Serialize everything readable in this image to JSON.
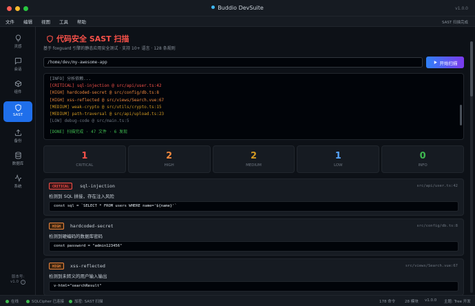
{
  "window": {
    "title": "Buddio DevSuite",
    "version": "v1.0.0",
    "traffic_lights": [
      "#ff5f57",
      "#febc2e",
      "#28c840"
    ]
  },
  "menu": {
    "items": [
      "文件",
      "编辑",
      "视图",
      "工具",
      "帮助"
    ],
    "status": "SAST 扫描完成"
  },
  "sidebar": {
    "items": [
      {
        "label": "灵感",
        "icon": "lightbulb-icon"
      },
      {
        "label": "会话",
        "icon": "chat-icon"
      },
      {
        "label": "组件",
        "icon": "box-icon"
      },
      {
        "label": "SAST",
        "icon": "shield-icon"
      },
      {
        "label": "备份",
        "icon": "upload-icon"
      },
      {
        "label": "数据库",
        "icon": "database-icon"
      },
      {
        "label": "系统",
        "icon": "activity-icon"
      }
    ],
    "active": "SAST",
    "version_label": "版本号",
    "version": "v1.0"
  },
  "page": {
    "title": "代码安全 SAST 扫描",
    "subtitle": "基于 foxguard 引擎的静态应用安全测试 · 支持 10+ 语言 · 128 条规则",
    "path_value": "/home/dev/my-awesome-app",
    "scan_button": "开始扫描"
  },
  "console": {
    "lines": [
      {
        "text": "[INFO] 分析依赖...",
        "level": "info"
      },
      {
        "text": "[CRITICAL] sql-injection @ src/api/user.ts:42",
        "level": "critical"
      },
      {
        "text": "[HIGH] hardcoded-secret @ src/config/db.ts:8",
        "level": "high"
      },
      {
        "text": "[HIGH] xss-reflected @ src/views/Search.vue:67",
        "level": "high"
      },
      {
        "text": "[MEDIUM] weak-crypto @ src/utils/crypto.ts:15",
        "level": "medium"
      },
      {
        "text": "[MEDIUM] path-traversal @ src/api/upload.ts:23",
        "level": "medium"
      },
      {
        "text": "[LOW] debug-code @ src/main.ts:5",
        "level": "low"
      },
      {
        "text": "[DONE] 扫描完成 · 47 文件 · 6 发现",
        "level": "done"
      }
    ]
  },
  "stats": [
    {
      "count": "1",
      "label": "CRITICAL",
      "color": "#f85149"
    },
    {
      "count": "2",
      "label": "HIGH",
      "color": "#f0883e"
    },
    {
      "count": "2",
      "label": "MEDIUM",
      "color": "#d29922"
    },
    {
      "count": "1",
      "label": "LOW",
      "color": "#58a6ff"
    },
    {
      "count": "0",
      "label": "INFO",
      "color": "#3fb950"
    }
  ],
  "findings": [
    {
      "severity": "CRITICAL",
      "rule": "sql-injection",
      "location": "src/api/user.ts:42",
      "description": "检测到 SQL 拼接，存在注入风险",
      "code": "const sql = `SELECT * FROM users WHERE name='${name}'`"
    },
    {
      "severity": "HIGH",
      "rule": "hardcoded-secret",
      "location": "src/config/db.ts:8",
      "description": "检测到硬编码的数据库密码",
      "code": "const password = \"admin123456\""
    },
    {
      "severity": "HIGH",
      "rule": "xss-reflected",
      "location": "src/views/Search.vue:67",
      "description": "检测到未转义的用户输入输出",
      "code": "v-html=\"searchResult\""
    }
  ],
  "statusbar": {
    "items": [
      "在线",
      "SQLCipher 已连接",
      "加密: SAST 扫描"
    ],
    "right": [
      "178 命令",
      "28 模块",
      "v1.0.0",
      "主题: Tree 开发"
    ]
  }
}
